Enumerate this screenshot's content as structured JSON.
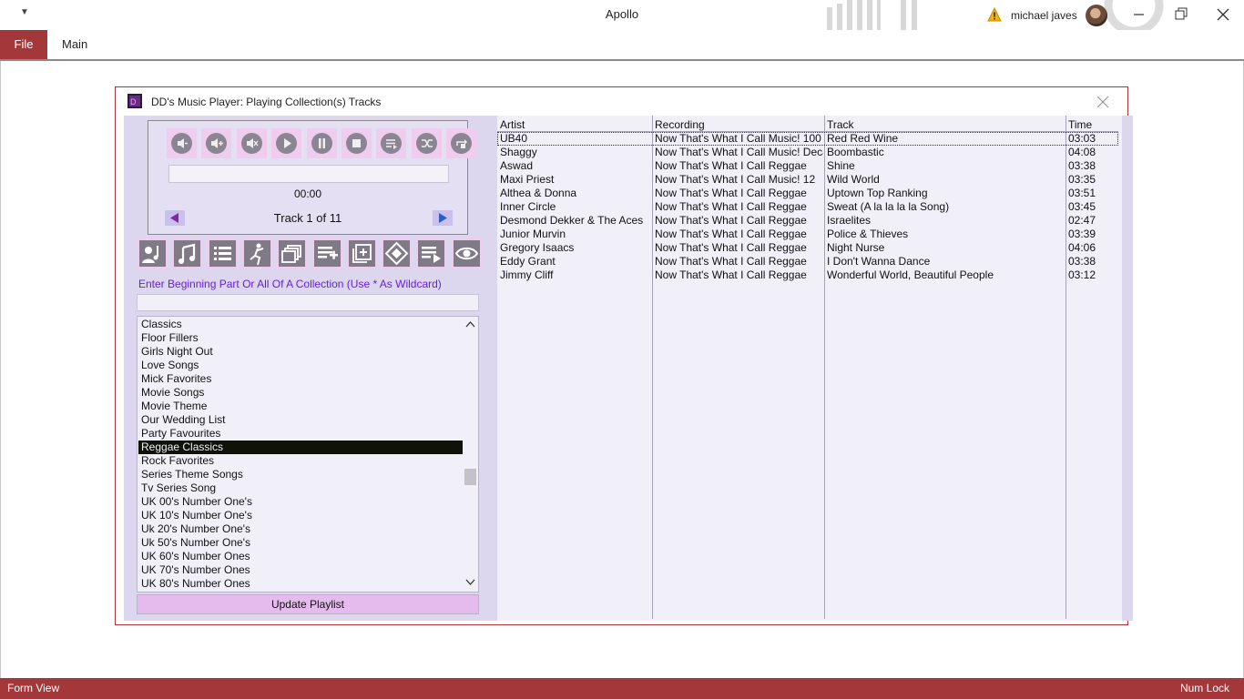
{
  "window": {
    "qat_icon": "customize-quick-access-icon",
    "title": "Apollo",
    "user_name": "michael javes"
  },
  "menu": {
    "file_label": "File",
    "main_label": "Main"
  },
  "status": {
    "left": "Form View",
    "right": "Num Lock"
  },
  "dialog": {
    "title": "DD's Music Player: Playing Collection(s) Tracks",
    "player": {
      "time": "00:00",
      "track_label": "Track 1 of 11",
      "progress": 0
    },
    "player_buttons": [
      "volume-down-icon",
      "volume-up-icon",
      "mute-icon",
      "play-icon",
      "pause-icon",
      "stop-icon",
      "playlist-icon",
      "shuffle-icon",
      "repeat-icon"
    ],
    "tool_buttons": [
      "artist-icon",
      "music-note-icon",
      "list-icon",
      "dance-icon",
      "collections-icon",
      "add-to-list-icon",
      "add-box-icon",
      "diamond-icon",
      "play-list-icon",
      "eye-icon"
    ],
    "search_hint": "Enter Beginning Part Or All Of A Collection (Use * As Wildcard)",
    "search_value": "",
    "collections": [
      "Classics",
      "Floor Fillers",
      "Girls Night Out",
      "Love Songs",
      "Mick Favorites",
      "Movie Songs",
      "Movie Theme",
      "Our Wedding List",
      "Party Favourites",
      "Reggae Classics",
      "Rock Favorites",
      "Series Theme Songs",
      "Tv Series Song",
      "UK 00's Number One's",
      "UK 10's Number One's",
      "Uk 20's Number One's",
      "Uk 50's Number One's",
      "UK 60's Number Ones",
      "UK 70's Number Ones",
      "UK 80's Number Ones"
    ],
    "selected_collection": "Reggae Classics",
    "update_button": "Update Playlist",
    "table": {
      "headers": [
        "Artist",
        "Recording",
        "Track",
        "Time"
      ],
      "rows": [
        [
          "UB40",
          "Now That's What I Call Music! 100",
          "Red Red Wine",
          "03:03"
        ],
        [
          "Shaggy",
          "Now That's What I Call Music! Decade",
          "Boombastic",
          "04:08"
        ],
        [
          "Aswad",
          "Now That's What I Call Reggae",
          "Shine",
          "03:38"
        ],
        [
          "Maxi Priest",
          "Now That's What I Call Music! 12",
          "Wild World",
          "03:35"
        ],
        [
          "Althea & Donna",
          "Now That's What I Call Reggae",
          "Uptown Top Ranking",
          "03:51"
        ],
        [
          "Inner Circle",
          "Now That's What I Call Reggae",
          "Sweat (A la la la la Song)",
          "03:45"
        ],
        [
          "Desmond Dekker & The Aces",
          "Now That's What I Call Reggae",
          "Israelites",
          "02:47"
        ],
        [
          "Junior Murvin",
          "Now That's What I Call Reggae",
          "Police & Thieves",
          "03:39"
        ],
        [
          "Gregory Isaacs",
          "Now That's What I Call Reggae",
          "Night Nurse",
          "04:06"
        ],
        [
          "Eddy Grant",
          "Now That's What I Call Reggae",
          "I Don't Wanna Dance",
          "03:38"
        ],
        [
          "Jimmy Cliff",
          "Now That's What I Call Reggae",
          "Wonderful World, Beautiful People",
          "03:12"
        ]
      ]
    }
  },
  "colors": {
    "accent": "#a4373a",
    "panel": "#dcd6ee",
    "list_bg": "#f1eff8",
    "button_bg": "#f0cdee",
    "hint_text": "#6a1fd6",
    "selection": "#0f1208"
  }
}
